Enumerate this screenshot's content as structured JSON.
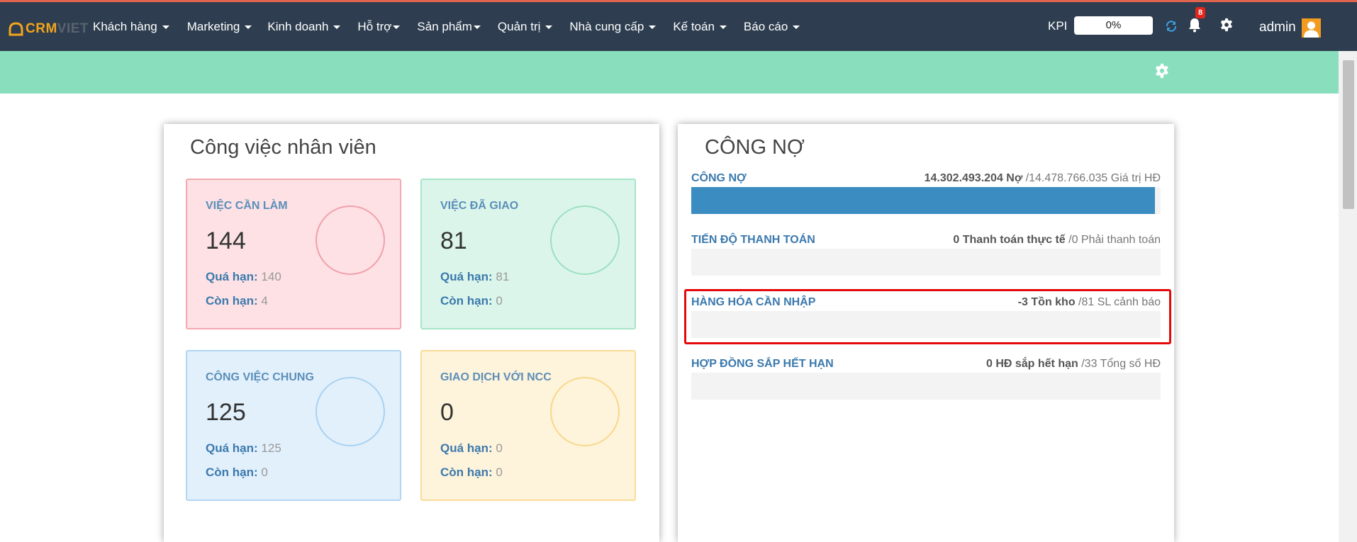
{
  "logo": {
    "part1": "CRM",
    "part2": "VIET"
  },
  "menu": [
    {
      "label": "Khách hàng"
    },
    {
      "label": "Marketing"
    },
    {
      "label": "Kinh doanh"
    },
    {
      "label": "Hỗ trợ"
    },
    {
      "label": "Sản phẩm"
    },
    {
      "label": "Quản trị"
    },
    {
      "label": "Nhà cung cấp"
    },
    {
      "label": "Kế toán"
    },
    {
      "label": "Báo cáo"
    }
  ],
  "header": {
    "kpi_label": "KPI",
    "kpi_value": "0%",
    "notification_count": "8",
    "user_name": "admin"
  },
  "tasks_panel": {
    "title": "Công việc nhân viên",
    "cards": [
      {
        "title": "VIỆC CẦN LÀM",
        "count": "144",
        "overdue_label": "Quá hạn:",
        "overdue_value": "140",
        "remaining_label": "Còn hạn:",
        "remaining_value": "4"
      },
      {
        "title": "VIỆC ĐÃ GIAO",
        "count": "81",
        "overdue_label": "Quá hạn:",
        "overdue_value": "81",
        "remaining_label": "Còn hạn:",
        "remaining_value": "0"
      },
      {
        "title": "CÔNG VIỆC CHUNG",
        "count": "125",
        "overdue_label": "Quá hạn:",
        "overdue_value": "125",
        "remaining_label": "Còn hạn:",
        "remaining_value": "0"
      },
      {
        "title": "GIAO DỊCH VỚI NCC",
        "count": "0",
        "overdue_label": "Quá hạn:",
        "overdue_value": "0",
        "remaining_label": "Còn hạn:",
        "remaining_value": "0"
      }
    ]
  },
  "debt_panel": {
    "title": "CÔNG NỢ",
    "rows": [
      {
        "label": "CÔNG NỢ",
        "value_bold": "14.302.493.204 Nợ",
        "value_rest": " /14.478.766.035 Giá trị HĐ",
        "progress": 0.988
      },
      {
        "label": "TIẾN ĐỘ THANH TOÁN",
        "value_bold": "0 Thanh toán thực tế",
        "value_rest": " /0 Phải thanh toán",
        "progress": 0
      },
      {
        "label": "HÀNG HÓA CẦN NHẬP",
        "value_bold": "-3 Tồn kho",
        "value_rest": " /81 SL cảnh báo",
        "progress": 0
      },
      {
        "label": "HỢP ĐỒNG SẮP HẾT HẠN",
        "value_bold": "0 HĐ sắp hết hạn",
        "value_rest": " /33 Tổng số HĐ",
        "progress": 0
      }
    ]
  },
  "colors": {
    "navbar": "#2e3e50",
    "subbar": "#89dfbd",
    "accent_blue": "#3b79ad",
    "progress_fill": "#3b8cc0",
    "highlight": "#e4080a"
  }
}
